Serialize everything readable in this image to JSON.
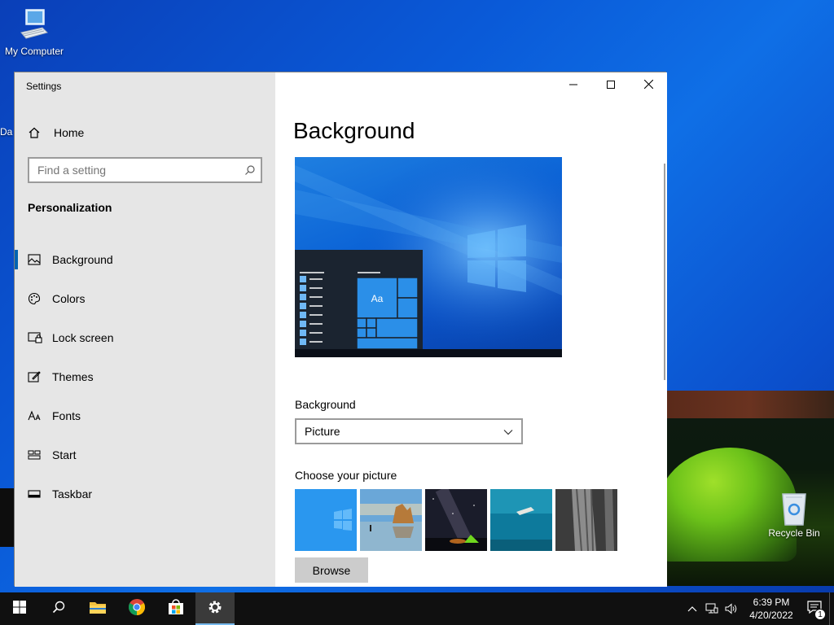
{
  "desktop": {
    "icons": [
      {
        "label": "My Computer",
        "icon": "computer-icon"
      },
      {
        "label": "Recycle Bin",
        "icon": "recycle-bin-icon"
      }
    ],
    "partial_label": "Da"
  },
  "window": {
    "title": "Settings",
    "home_label": "Home",
    "search_placeholder": "Find a setting",
    "section_label": "Personalization",
    "nav_items": [
      {
        "label": "Background",
        "icon": "picture-icon",
        "active": true
      },
      {
        "label": "Colors",
        "icon": "palette-icon",
        "active": false
      },
      {
        "label": "Lock screen",
        "icon": "lock-screen-icon",
        "active": false
      },
      {
        "label": "Themes",
        "icon": "themes-icon",
        "active": false
      },
      {
        "label": "Fonts",
        "icon": "fonts-icon",
        "active": false
      },
      {
        "label": "Start",
        "icon": "start-icon",
        "active": false
      },
      {
        "label": "Taskbar",
        "icon": "taskbar-icon",
        "active": false
      }
    ],
    "controls": {
      "minimize": "minimize-icon",
      "maximize": "maximize-icon",
      "close": "close-icon"
    }
  },
  "content": {
    "page_title": "Background",
    "preview_tile_text": "Aa",
    "background_label": "Background",
    "background_value": "Picture",
    "choose_label": "Choose your picture",
    "thumbnails": [
      {
        "name": "windows-hero",
        "selected": true
      },
      {
        "name": "beach-rocks",
        "selected": false
      },
      {
        "name": "night-sky-tent",
        "selected": false
      },
      {
        "name": "underwater-swimmer",
        "selected": false
      },
      {
        "name": "tree-bark",
        "selected": false
      }
    ],
    "browse_label": "Browse"
  },
  "taskbar": {
    "apps": [
      "start-icon",
      "search-icon",
      "file-explorer-icon",
      "chrome-icon",
      "store-icon",
      "settings-icon"
    ],
    "active_app": "settings-icon",
    "time": "6:39 PM",
    "date": "4/20/2022",
    "notification_count": "1"
  },
  "colors": {
    "accent": "#0063b1",
    "sidebar": "#e6e6e6",
    "taskbar": "#101010",
    "desktop": "#0a5ad8"
  }
}
